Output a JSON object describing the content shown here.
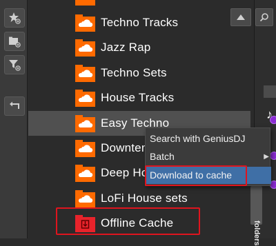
{
  "toolbar": {
    "buttons": [
      {
        "icon": "star-add-icon"
      },
      {
        "icon": "folder-add-icon"
      },
      {
        "icon": "filter-add-icon"
      },
      {
        "icon": "back-arrow-icon"
      }
    ]
  },
  "folders": [
    {
      "label": "Techno Tracks",
      "icon": "soundcloud-folder-icon"
    },
    {
      "label": "Jazz Rap",
      "icon": "soundcloud-folder-icon"
    },
    {
      "label": "Techno Sets",
      "icon": "soundcloud-folder-icon"
    },
    {
      "label": "House Tracks",
      "icon": "soundcloud-folder-icon"
    },
    {
      "label": "Easy Techno",
      "icon": "soundcloud-folder-icon",
      "selected": true
    },
    {
      "label": "Downtempo",
      "icon": "soundcloud-folder-icon"
    },
    {
      "label": "Deep House",
      "icon": "soundcloud-folder-icon"
    },
    {
      "label": "LoFi House sets",
      "icon": "soundcloud-folder-icon"
    },
    {
      "label": "Offline Cache",
      "icon": "offline-cache-folder-icon"
    }
  ],
  "context_menu": {
    "items": [
      {
        "label": "Search with GeniusDJ",
        "has_submenu": false
      },
      {
        "label": "Batch",
        "has_submenu": true
      },
      {
        "label": "Download to cache",
        "has_submenu": false,
        "highlighted": true
      }
    ]
  },
  "side_tab": {
    "label": "folders"
  },
  "colors": {
    "soundcloud_orange": "#ff6a00",
    "offline_red": "#e8232b",
    "highlight_blue": "#3f6fa6",
    "annotation_red": "#e0141e"
  }
}
